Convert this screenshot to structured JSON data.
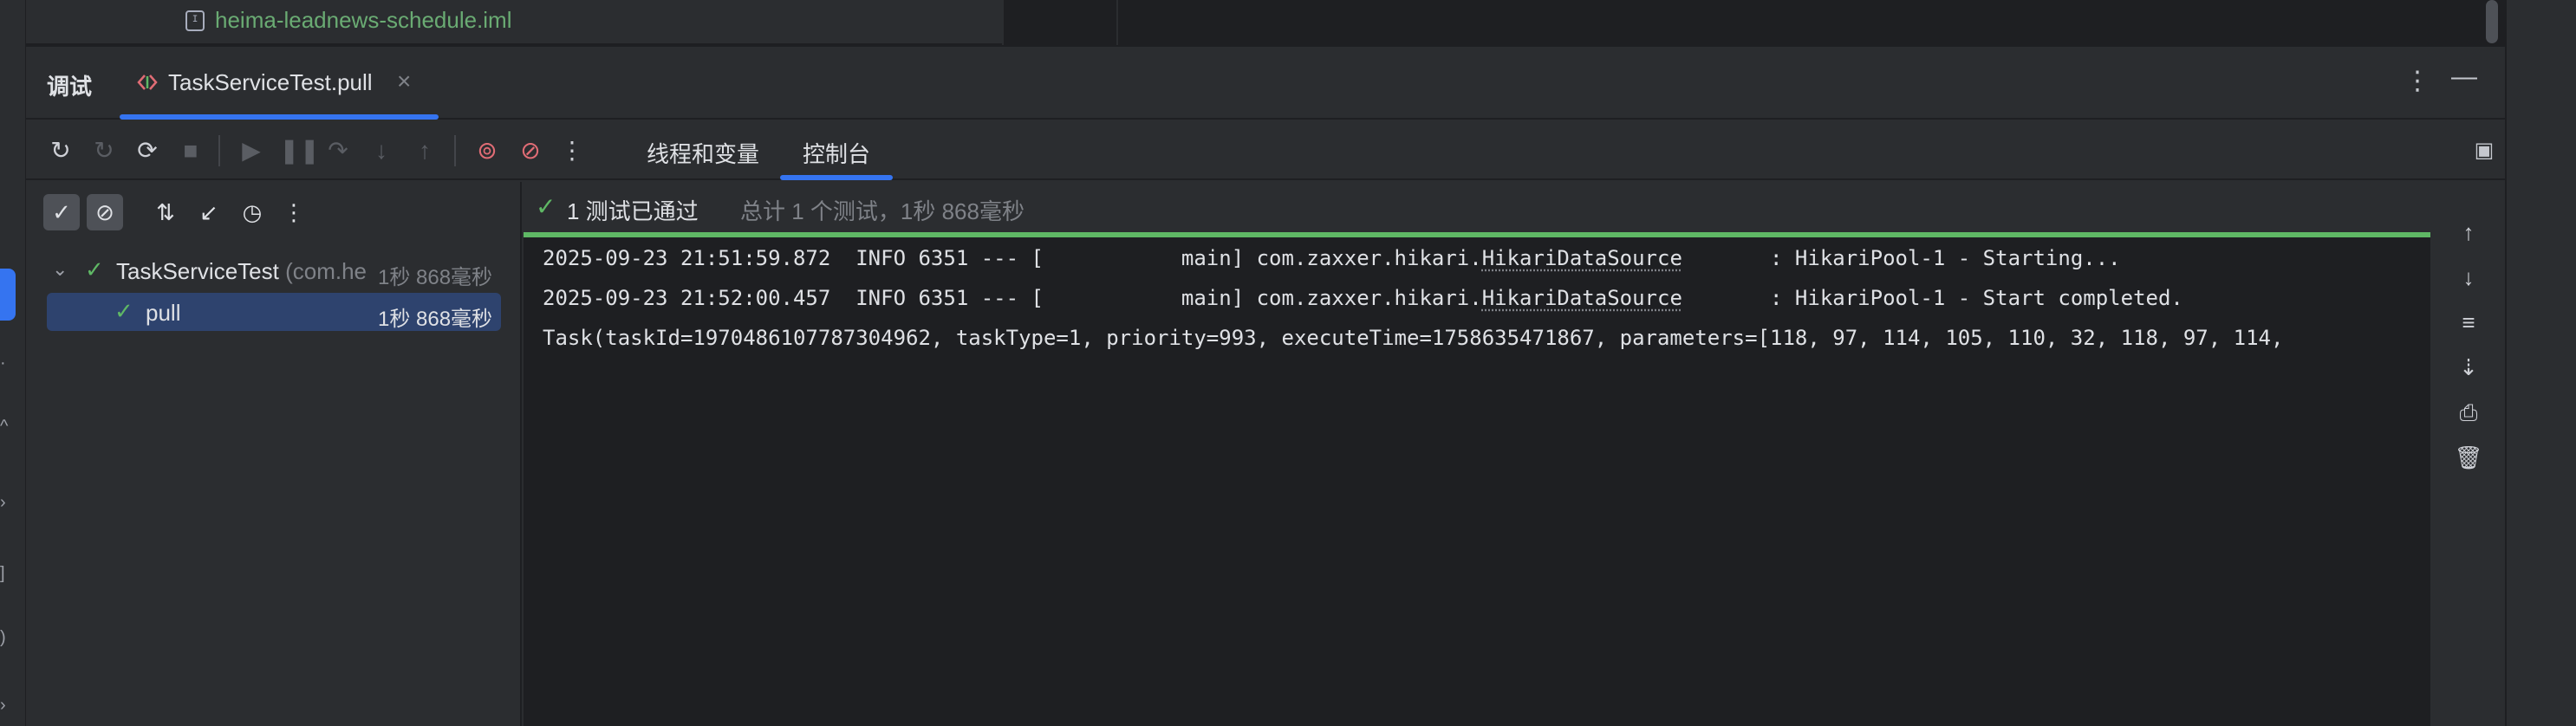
{
  "project_tree": {
    "iml_file": "heima-leadnews-schedule.iml"
  },
  "panel": {
    "title": "调试",
    "run_tab_label": "TaskServiceTest.pull",
    "close_glyph": "×",
    "more_glyph": "⋮",
    "minimize_glyph": "—"
  },
  "toolbar": {
    "more_glyph": "⋮",
    "sub_tabs": [
      "线程和变量",
      "控制台"
    ],
    "active_sub_tab": "控制台"
  },
  "test_tree": {
    "suite": {
      "name": "TaskServiceTest",
      "package": "(com.he",
      "duration": "1秒 868毫秒"
    },
    "test": {
      "name": "pull",
      "duration": "1秒 868毫秒"
    }
  },
  "status": {
    "summary": "1 测试已通过",
    "detail": "总计 1 个测试，1秒 868毫秒",
    "progress_fraction": 1.0
  },
  "console": {
    "lines": [
      {
        "prefix": "2025-09-23 21:51:59.872  INFO 6351 --- [           main] com.zaxxer.hikari.",
        "underlined": "HikariDataSource",
        "suffix": "       : HikariPool-1 - Starting..."
      },
      {
        "prefix": "2025-09-23 21:52:00.457  INFO 6351 --- [           main] com.zaxxer.hikari.",
        "underlined": "HikariDataSource",
        "suffix": "       : HikariPool-1 - Start completed."
      },
      {
        "prefix": "Task(taskId=1970486107787304962, taskType=1, priority=993, executeTime=1758635471867, parameters=[118, 97, 114, 105, 110, 32, 118, 97, 114,",
        "underlined": "",
        "suffix": ""
      }
    ]
  },
  "colors": {
    "accent": "#3574f0",
    "pass": "#5fb865",
    "background": "#1e1f22",
    "panel": "#2b2d30"
  }
}
